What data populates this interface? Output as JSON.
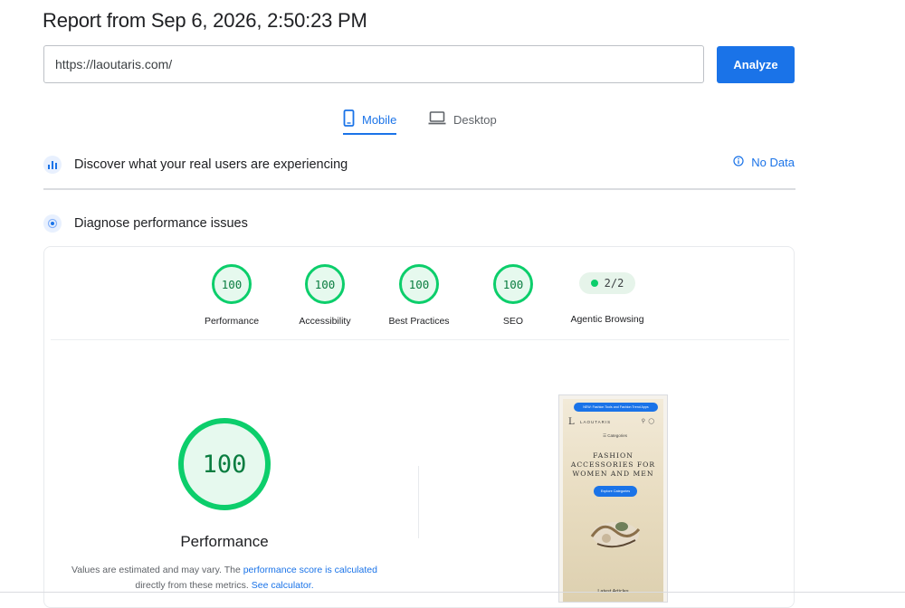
{
  "report": {
    "title": "Report from Sep 6, 2026, 2:50:23 PM"
  },
  "url_bar": {
    "value": "https://laoutaris.com/",
    "analyze_label": "Analyze"
  },
  "tabs": [
    {
      "label": "Mobile",
      "active": true
    },
    {
      "label": "Desktop",
      "active": false
    }
  ],
  "crux": {
    "title": "Discover what your real users are experiencing",
    "status": "No Data"
  },
  "diagnose": {
    "title": "Diagnose performance issues"
  },
  "scores": [
    {
      "label": "Performance",
      "value": "100"
    },
    {
      "label": "Accessibility",
      "value": "100"
    },
    {
      "label": "Best Practices",
      "value": "100"
    },
    {
      "label": "SEO",
      "value": "100"
    }
  ],
  "agentic": {
    "label": "Agentic Browsing",
    "value": "2/2"
  },
  "main_score": {
    "value": "100",
    "label": "Performance",
    "disclaimer_prefix": "Values are estimated and may vary. The",
    "score_link": "performance score is calculated",
    "disclaimer_middle": "directly from these metrics.",
    "calculator_link": "See calculator."
  },
  "screenshot": {
    "banner": "NEW: Fashion Tools and Fashion Trend Apps",
    "logo": "L",
    "brand": "LAOUTARIS",
    "categories": "Categories",
    "heading_lines": [
      "FASHION",
      "ACCESSORIES FOR",
      "WOMEN AND MEN"
    ],
    "button": "Explore Categories",
    "latest": "Latest Articles"
  },
  "colors": {
    "accent": "#1a73e8",
    "pass": "#0cce6b",
    "pass_text": "#0a7d40"
  },
  "icons": {
    "mobile": "smartphone-icon",
    "desktop": "laptop-icon",
    "crux": "bar-chart-icon",
    "diagnose": "target-icon",
    "info": "info-icon"
  }
}
